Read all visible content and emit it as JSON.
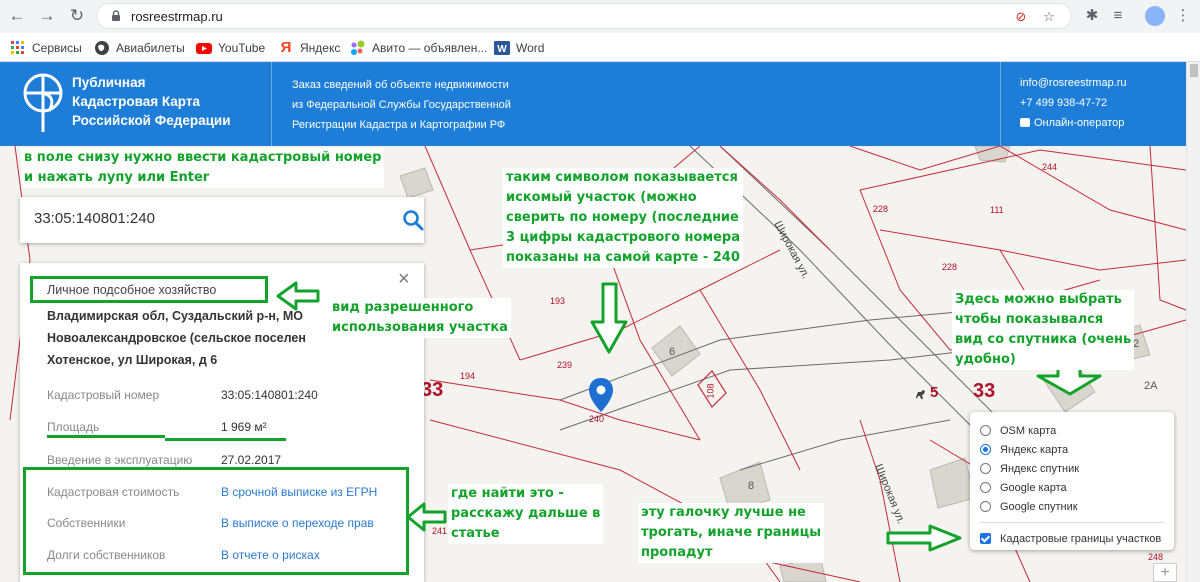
{
  "browser": {
    "url": "rosreestrmap.ru",
    "bookmarks": [
      "Сервисы",
      "Авиабилеты",
      "YouTube",
      "Яндекс",
      "Авито — объявлен...",
      "Word"
    ]
  },
  "header": {
    "brand_lines": [
      "Публичная",
      "Кадастровая Карта",
      "Российской Федерации"
    ],
    "desc_lines": [
      "Заказ сведений об объекте недвижимости",
      "из Федеральной Службы Государственной",
      "Регистрации Кадастра и Картографии РФ"
    ],
    "email": "info@rosreestrmap.ru",
    "phone": "+7 499 938-47-72",
    "chat": "Онлайн-оператор"
  },
  "search": {
    "value": "33:05:140801:240"
  },
  "panel": {
    "usage": "Личное подсобное хозяйство",
    "address_lines": [
      "Владимирская обл, Суздальский р-н, МО",
      "Новоалександровское (сельское поселен",
      "Хотенское, ул Широкая, д 6"
    ],
    "rows": [
      {
        "label": "Кадастровый номер",
        "value": "33:05:140801:240"
      },
      {
        "label": "Площадь",
        "value": "1 969 м²"
      },
      {
        "label": "Введение в эксплуатацию",
        "value": "27.02.2017"
      }
    ],
    "links": [
      {
        "label": "Кадастровая стоимость",
        "value": "В срочной выписке из ЕГРН"
      },
      {
        "label": "Собственники",
        "value": "В выписке о переходе прав"
      },
      {
        "label": "Долги собственников",
        "value": "В отчете о рисках"
      }
    ]
  },
  "map": {
    "parcels": [
      "244",
      "228",
      "111",
      "228",
      "193",
      "239",
      "194",
      "240",
      "108",
      "248",
      "241"
    ],
    "houses": [
      "6",
      "8",
      "5",
      "2",
      "2А"
    ],
    "quarters": [
      "33",
      "33"
    ],
    "streets": [
      "Широкая ул.",
      "Широкая ул."
    ]
  },
  "layers": {
    "options": [
      {
        "label": "OSM карта",
        "selected": false
      },
      {
        "label": "Яндекс карта",
        "selected": true
      },
      {
        "label": "Яндекс спутник",
        "selected": false
      },
      {
        "label": "Google карта",
        "selected": false
      },
      {
        "label": "Google спутник",
        "selected": false
      }
    ],
    "cadastral_label": "Кадастровые границы участков",
    "cadastral_checked": true
  },
  "zoom": {
    "in_label": "+"
  },
  "annotations": {
    "a1": [
      "в поле снизу нужно ввести кадастровый номер",
      "и нажать лупу или Enter"
    ],
    "a2": [
      "таким символом  показывается",
      "искомый участок (можно",
      "сверить по номеру (последние",
      "3 цифры кадастрового номера",
      "показаны на самой карте - 240"
    ],
    "a3": [
      "вид разрешенного",
      "использования участка"
    ],
    "a4": [
      "Здесь можно выбрать",
      "чтобы показывался",
      "вид со спутника (очень",
      "удобно)"
    ],
    "a5": [
      "где найти это -",
      "расскажу дальше в",
      "статье"
    ],
    "a6": [
      "эту галочку лучше не",
      "трогать, иначе границы",
      "пропадут"
    ]
  }
}
